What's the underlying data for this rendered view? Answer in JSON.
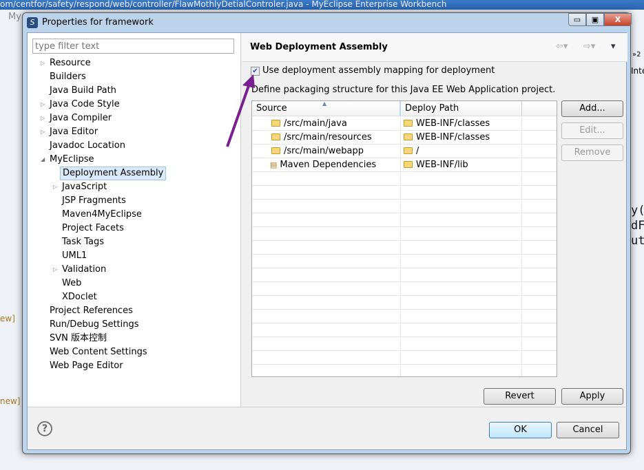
{
  "ide": {
    "title": "om/centfor/safety/respond/web/controller/FlawMothlyDetialControler.java - MyEclipse Enterprise Workbench",
    "menu_fragment": "My",
    "left_fragments": [
      "ew]",
      "new]"
    ],
    "right_fragments": [
      "y(",
      "dF",
      "ut",
      "»2",
      "Inte"
    ]
  },
  "dialog": {
    "title": "Properties for framework",
    "filter_placeholder": "type filter text",
    "tree": [
      {
        "label": "Resource",
        "level": 0,
        "expandable": true
      },
      {
        "label": "Builders",
        "level": 0
      },
      {
        "label": "Java Build Path",
        "level": 0
      },
      {
        "label": "Java Code Style",
        "level": 0,
        "expandable": true
      },
      {
        "label": "Java Compiler",
        "level": 0,
        "expandable": true
      },
      {
        "label": "Java Editor",
        "level": 0,
        "expandable": true
      },
      {
        "label": "Javadoc Location",
        "level": 0
      },
      {
        "label": "MyEclipse",
        "level": 0,
        "expanded": true
      },
      {
        "label": "Deployment Assembly",
        "level": 1,
        "selected": true
      },
      {
        "label": "JavaScript",
        "level": 1,
        "expandable": true
      },
      {
        "label": "JSP Fragments",
        "level": 1
      },
      {
        "label": "Maven4MyEclipse",
        "level": 1
      },
      {
        "label": "Project Facets",
        "level": 1
      },
      {
        "label": "Task Tags",
        "level": 1
      },
      {
        "label": "UML1",
        "level": 1
      },
      {
        "label": "Validation",
        "level": 1,
        "expandable": true
      },
      {
        "label": "Web",
        "level": 1
      },
      {
        "label": "XDoclet",
        "level": 1
      },
      {
        "label": "Project References",
        "level": 0
      },
      {
        "label": "Run/Debug Settings",
        "level": 0
      },
      {
        "label": "SVN 版本控制",
        "level": 0
      },
      {
        "label": "Web Content Settings",
        "level": 0
      },
      {
        "label": "Web Page Editor",
        "level": 0
      }
    ],
    "page": {
      "title": "Web Deployment Assembly",
      "checkbox_label": "Use deployment assembly mapping for deployment",
      "checkbox_checked": true,
      "description": "Define packaging structure for this Java EE Web Application project.",
      "columns": [
        "Source",
        "Deploy Path"
      ],
      "rows": [
        {
          "source": "/src/main/java",
          "deploy": "WEB-INF/classes",
          "icon": "folder-icon"
        },
        {
          "source": "/src/main/resources",
          "deploy": "WEB-INF/classes",
          "icon": "folder-icon"
        },
        {
          "source": "/src/main/webapp",
          "deploy": "/",
          "icon": "folder-icon"
        },
        {
          "source": "Maven Dependencies",
          "deploy": "WEB-INF/lib",
          "icon": "library-icon"
        }
      ],
      "buttons": {
        "add": "Add...",
        "edit": "Edit...",
        "remove": "Remove",
        "revert": "Revert",
        "apply": "Apply"
      }
    },
    "footer": {
      "help": "?",
      "ok": "OK",
      "cancel": "Cancel"
    },
    "window_buttons": {
      "minimize": "▭",
      "maximize": "▣",
      "close": "X"
    }
  },
  "annotation": {
    "arrow_color": "#7a1f8f"
  }
}
